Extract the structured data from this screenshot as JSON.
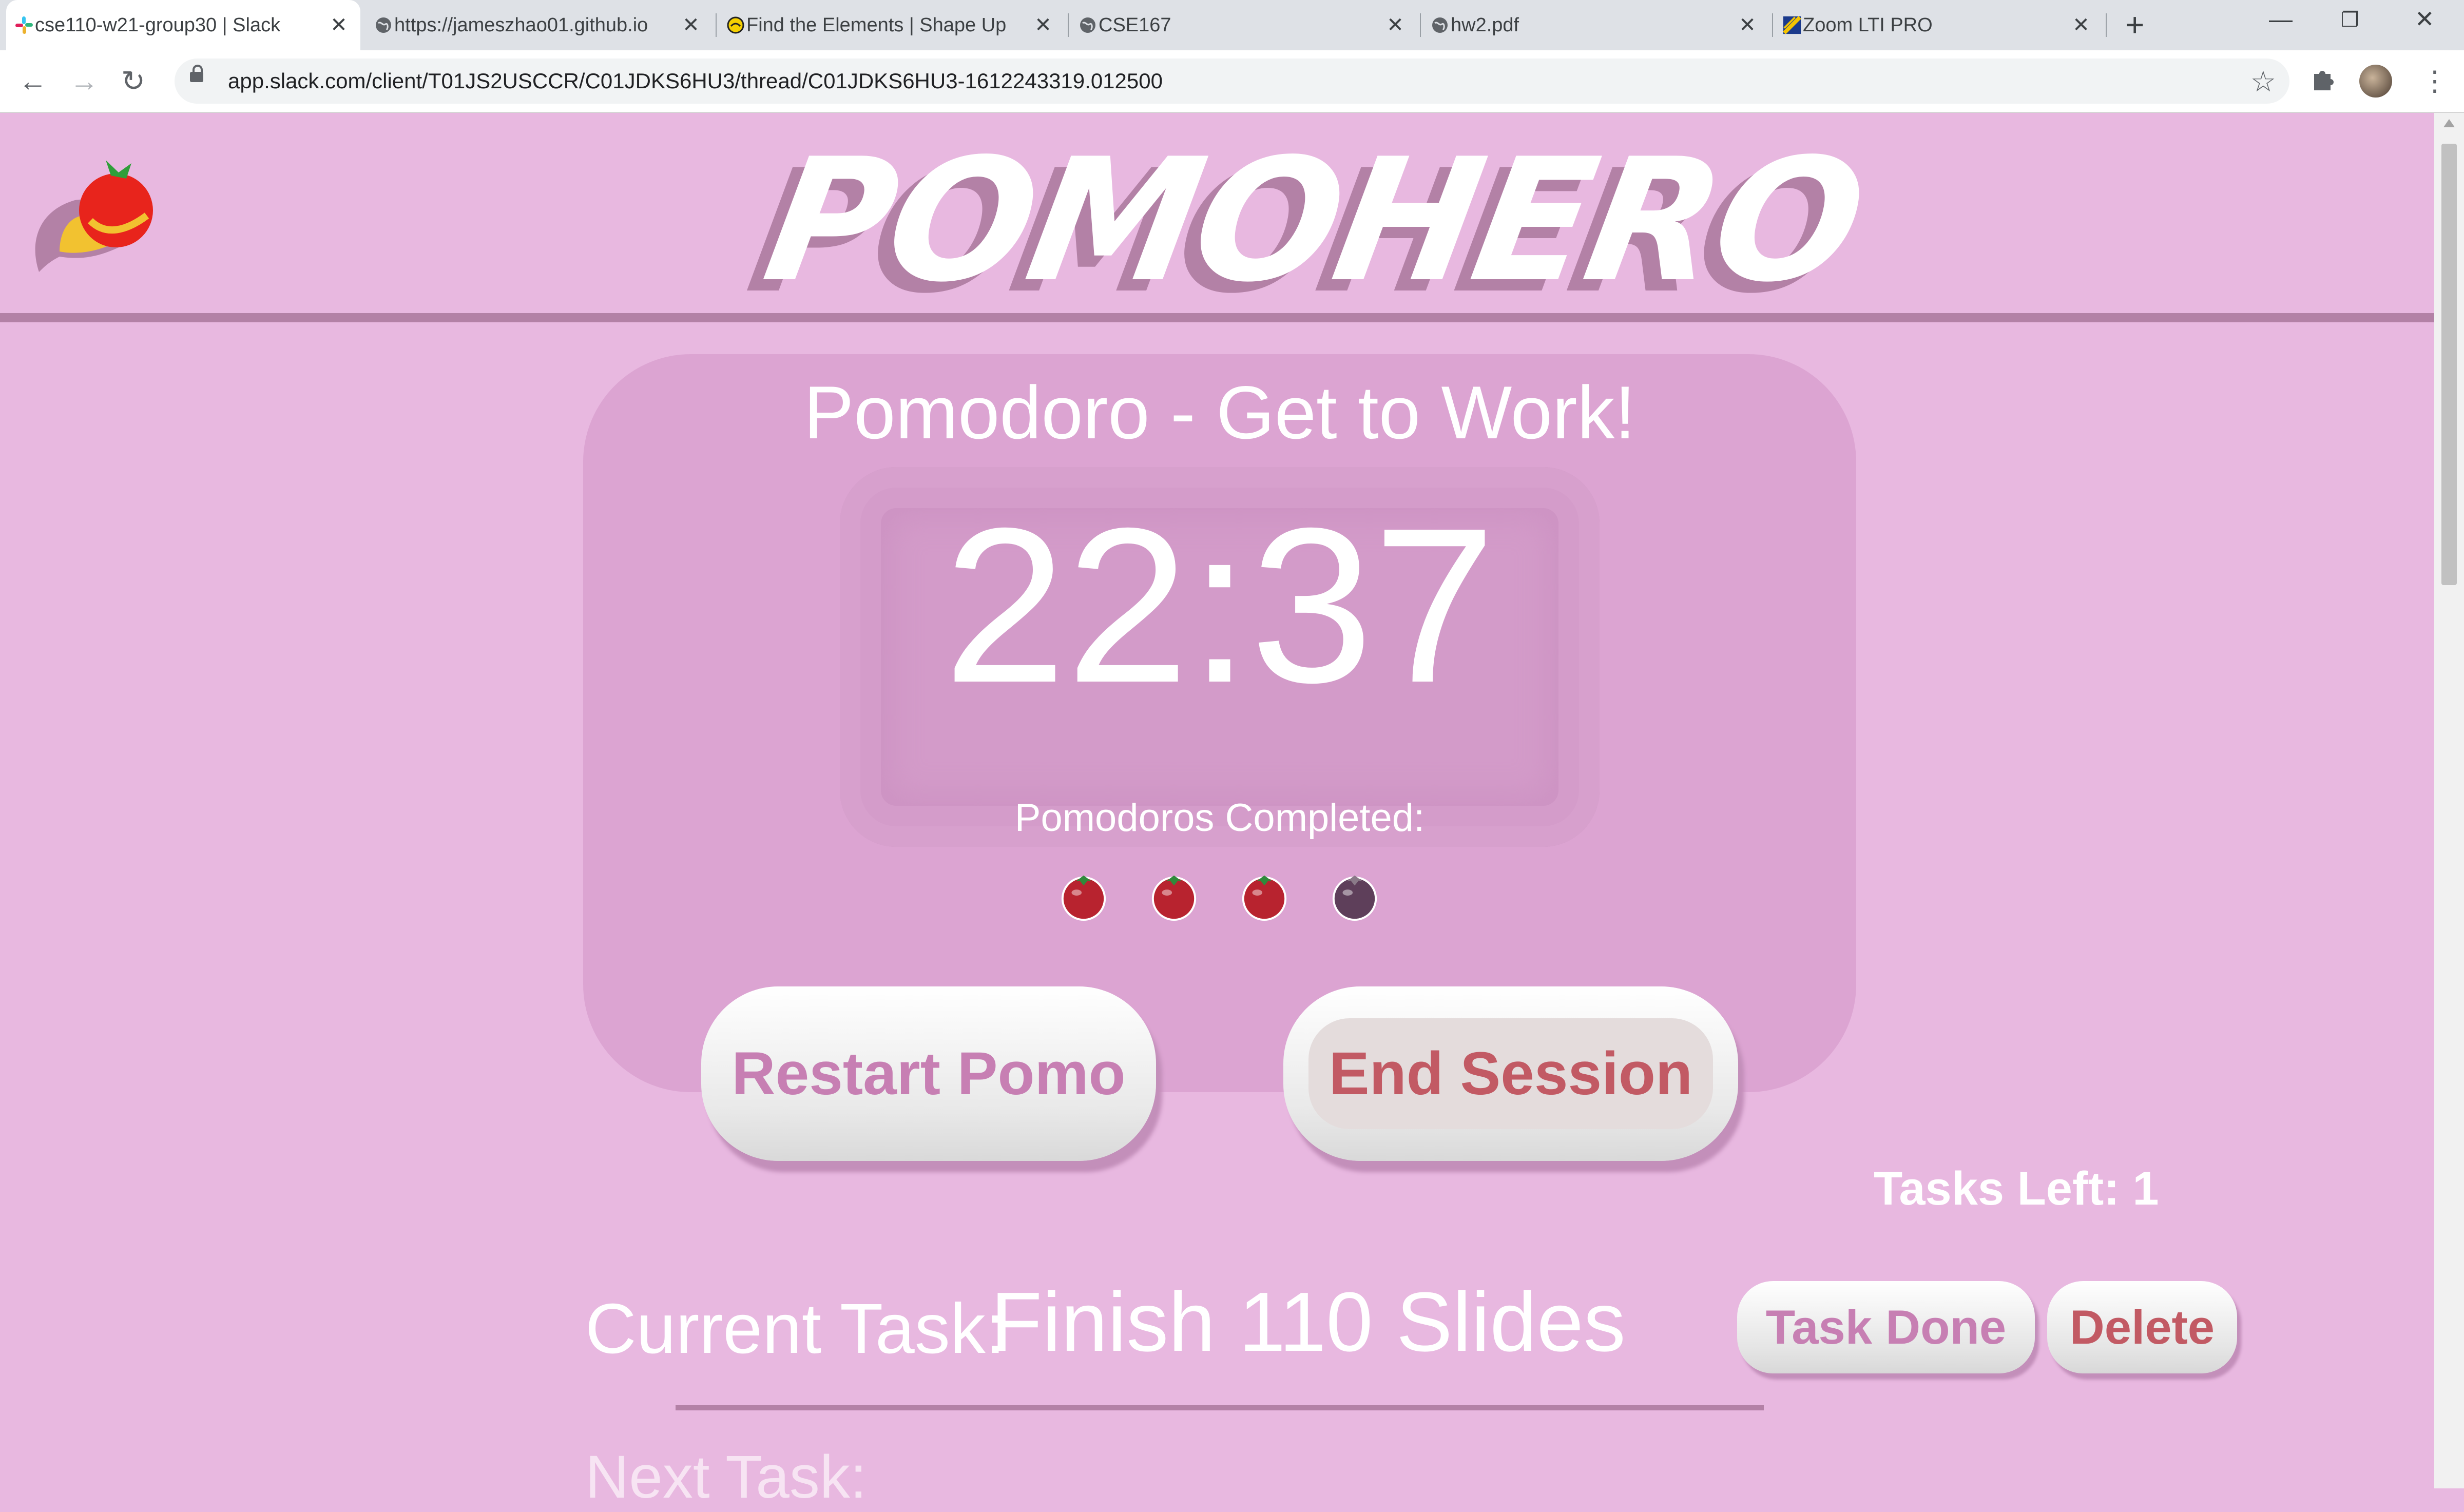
{
  "browser": {
    "tabs": [
      {
        "title": "cse110-w21-group30 | Slack",
        "icon": "slack-icon",
        "active": true
      },
      {
        "title": "https://jameszhao01.github.io",
        "icon": "globe-icon",
        "active": false
      },
      {
        "title": "Find the Elements | Shape Up",
        "icon": "shapeup-icon",
        "active": false
      },
      {
        "title": "CSE167",
        "icon": "globe-icon",
        "active": false
      },
      {
        "title": "hw2.pdf",
        "icon": "globe-icon",
        "active": false
      },
      {
        "title": "Zoom LTI PRO",
        "icon": "zoom-lti-icon",
        "active": false
      }
    ],
    "url": "app.slack.com/client/T01JS2USCCR/C01JDKS6HU3/thread/C01JDKS6HU3-1612243319.012500"
  },
  "app": {
    "brand": "POMOHERO",
    "mode_title": "Pomodoro - Get to Work!",
    "timer": "22:37",
    "completed_label": "Pomodoros Completed:",
    "pomodoros": {
      "completed": 3,
      "total": 4
    },
    "restart_label": "Restart Pomo",
    "end_label": "End Session",
    "tasks_left": "Tasks Left: 1",
    "current_task_label": "Current Task:",
    "current_task": "Finish 110 Slides",
    "task_done_label": "Task Done",
    "delete_label": "Delete",
    "next_task_label": "Next Task:"
  },
  "colors": {
    "background": "#e8b8e0",
    "card": "#dca4d2",
    "accent_rule": "#b381a6",
    "restart_text": "#c77fb3",
    "end_text": "#c25a64"
  }
}
